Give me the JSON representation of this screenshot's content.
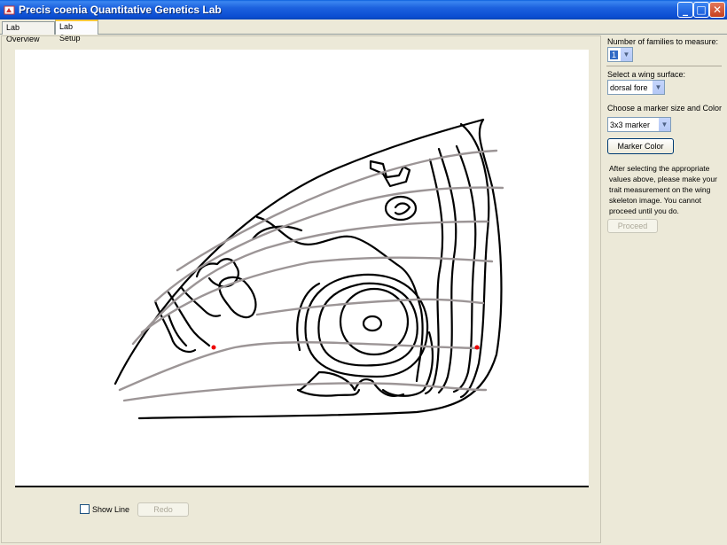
{
  "window": {
    "title": "Precis coenia Quantitative Genetics Lab",
    "controls": {
      "minimize": "_",
      "maximize": "□",
      "close": "✕"
    }
  },
  "tabs": [
    {
      "label": "Lab Overview",
      "active": false
    },
    {
      "label": "Lab Setup",
      "active": true
    }
  ],
  "canvas": {
    "image": "wing-skeleton"
  },
  "bottom_controls": {
    "show_line_label": "Show Line",
    "show_line_checked": false,
    "redo_label": "Redo"
  },
  "setup": {
    "families_label": "Number of families to measure:",
    "families_value": "1",
    "surface_label": "Select a wing surface:",
    "surface_value": "dorsal fore",
    "marker_label": "Choose a marker size and Color",
    "marker_value": "3x3 marker",
    "marker_color_button": "Marker Color",
    "instructions": "After selecting the appropriate values above, please make your trait measurement on the wing skeleton image.  You cannot proceed until you do.",
    "proceed_button": "Proceed"
  },
  "icons": {
    "combo_arrow": "chevron-down-icon",
    "app": "app-icon"
  }
}
